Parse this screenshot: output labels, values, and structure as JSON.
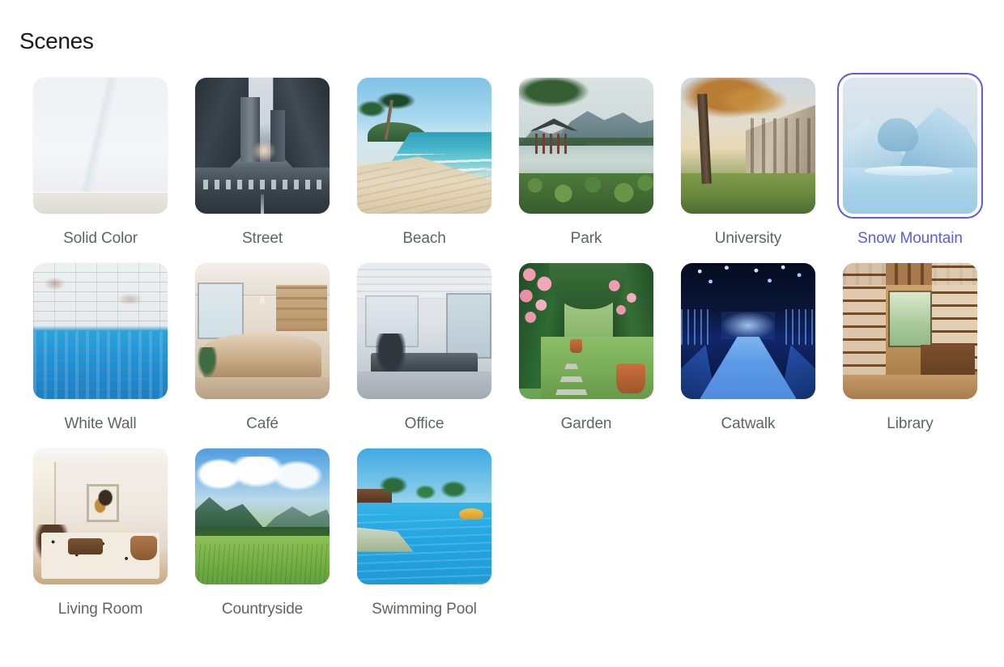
{
  "header": {
    "title": "Scenes"
  },
  "selection": {
    "selected_label": "Snow Mountain",
    "accent_color": "#5b5be8",
    "label_color": "#5f6368",
    "background": "#ffffff"
  },
  "scenes": [
    {
      "label": "Solid Color",
      "art": "art-solid",
      "selected": false
    },
    {
      "label": "Street",
      "art": "art-street",
      "selected": false
    },
    {
      "label": "Beach",
      "art": "art-beach",
      "selected": false
    },
    {
      "label": "Park",
      "art": "art-park",
      "selected": false
    },
    {
      "label": "University",
      "art": "art-univ",
      "selected": false
    },
    {
      "label": "Snow Mountain",
      "art": "art-snow",
      "selected": true
    },
    {
      "label": "White Wall",
      "art": "art-wall",
      "selected": false
    },
    {
      "label": "Café",
      "art": "art-cafe",
      "selected": false
    },
    {
      "label": "Office",
      "art": "art-office",
      "selected": false
    },
    {
      "label": "Garden",
      "art": "art-garden",
      "selected": false
    },
    {
      "label": "Catwalk",
      "art": "art-catwalk",
      "selected": false
    },
    {
      "label": "Library",
      "art": "art-library",
      "selected": false
    },
    {
      "label": "Living Room",
      "art": "art-living",
      "selected": false
    },
    {
      "label": "Countryside",
      "art": "art-country",
      "selected": false
    },
    {
      "label": "Swimming Pool",
      "art": "art-pool",
      "selected": false
    }
  ]
}
